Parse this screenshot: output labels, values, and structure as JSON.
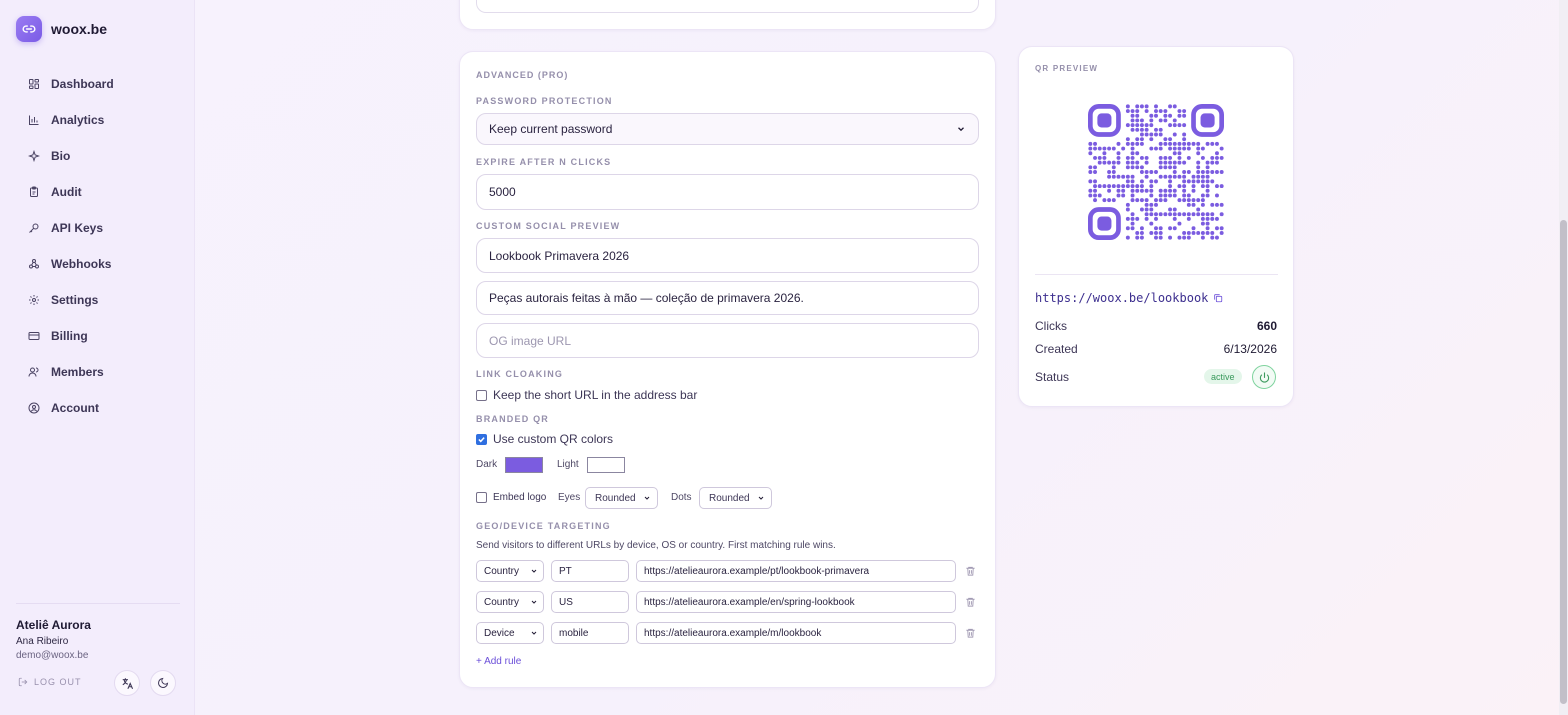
{
  "brand": {
    "name": "woox.be",
    "logo_icon": "link-icon",
    "accent": "#7a5be6"
  },
  "sidebar": {
    "items": [
      {
        "label": "Dashboard",
        "icon": "grid-icon"
      },
      {
        "label": "Analytics",
        "icon": "bar-chart-icon"
      },
      {
        "label": "Bio",
        "icon": "sparkle-icon"
      },
      {
        "label": "Audit",
        "icon": "clipboard-icon"
      },
      {
        "label": "API Keys",
        "icon": "key-icon"
      },
      {
        "label": "Webhooks",
        "icon": "webhook-icon"
      },
      {
        "label": "Settings",
        "icon": "gear-icon"
      },
      {
        "label": "Billing",
        "icon": "credit-card-icon"
      },
      {
        "label": "Members",
        "icon": "users-icon"
      },
      {
        "label": "Account",
        "icon": "user-circle-icon"
      }
    ]
  },
  "user": {
    "org": "Ateliê Aurora",
    "name": "Ana Ribeiro",
    "email": "demo@woox.be",
    "logout_label": "LOG OUT"
  },
  "form": {
    "section_title": "ADVANCED (PRO)",
    "password": {
      "label": "PASSWORD PROTECTION",
      "value": "Keep current password"
    },
    "expire": {
      "label": "EXPIRE AFTER N CLICKS",
      "value": "5000"
    },
    "social": {
      "label": "CUSTOM SOCIAL PREVIEW",
      "title_value": "Lookbook Primavera 2026",
      "description_value": "Peças autorais feitas à mão — coleção de primavera 2026.",
      "image_placeholder": "OG image URL"
    },
    "cloaking": {
      "label": "LINK CLOAKING",
      "checkbox_label": "Keep the short URL in the address bar",
      "checked": false
    },
    "branded_qr": {
      "label": "BRANDED QR",
      "checkbox_label": "Use custom QR colors",
      "checked": true,
      "dark_label": "Dark",
      "dark_color": "#7b5ce0",
      "light_label": "Light",
      "light_color": "#ffffff",
      "embed_logo_label": "Embed logo",
      "embed_logo_checked": false,
      "eyes_label": "Eyes",
      "eyes_value": "Rounded",
      "dots_label": "Dots",
      "dots_value": "Rounded"
    },
    "geo": {
      "label": "GEO/DEVICE TARGETING",
      "help": "Send visitors to different URLs by device, OS or country. First matching rule wins.",
      "rules": [
        {
          "type": "Country",
          "value": "PT",
          "url": "https://atelieaurora.example/pt/lookbook-primavera"
        },
        {
          "type": "Country",
          "value": "US",
          "url": "https://atelieaurora.example/en/spring-lookbook"
        },
        {
          "type": "Device",
          "value": "mobile",
          "url": "https://atelieaurora.example/m/lookbook"
        }
      ],
      "add_rule_label": "+ Add rule"
    }
  },
  "preview": {
    "label": "QR PREVIEW",
    "short_url": "https://woox.be/lookbook",
    "clicks_label": "Clicks",
    "clicks_value": "660",
    "created_label": "Created",
    "created_value": "6/13/2026",
    "status_label": "Status",
    "status_value": "active",
    "status_color": "#3a9a5c"
  }
}
